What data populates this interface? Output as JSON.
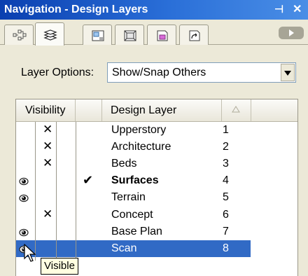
{
  "window": {
    "title": "Navigation - Design Layers",
    "pin_glyph": "⊣",
    "close_glyph": "✕"
  },
  "tabs": [
    {
      "name": "classes-tab-icon"
    },
    {
      "name": "design-layers-tab-icon"
    },
    {
      "name": "sheet-layers-tab-icon"
    },
    {
      "name": "viewports-tab-icon"
    },
    {
      "name": "saved-views-tab-icon"
    },
    {
      "name": "referenced-files-tab-icon"
    }
  ],
  "layer_options": {
    "label": "Layer Options:",
    "selected": "Show/Snap Others"
  },
  "table": {
    "headers": {
      "visibility": "Visibility",
      "design_layer": "Design Layer"
    },
    "rows": [
      {
        "name": "Upperstory",
        "num": "1",
        "state": "invisible",
        "active": false,
        "bold": false
      },
      {
        "name": "Architecture",
        "num": "2",
        "state": "invisible",
        "active": false,
        "bold": false
      },
      {
        "name": "Beds",
        "num": "3",
        "state": "invisible",
        "active": false,
        "bold": false
      },
      {
        "name": "Surfaces",
        "num": "4",
        "state": "visible",
        "active": true,
        "bold": true
      },
      {
        "name": "Terrain",
        "num": "5",
        "state": "visible",
        "active": false,
        "bold": false
      },
      {
        "name": "Concept",
        "num": "6",
        "state": "invisible",
        "active": false,
        "bold": false
      },
      {
        "name": "Base Plan",
        "num": "7",
        "state": "visible",
        "active": false,
        "bold": false
      },
      {
        "name": "Scan",
        "num": "8",
        "state": "visible",
        "active": false,
        "bold": false,
        "selected": true
      }
    ]
  },
  "tooltip": "Visible",
  "colors": {
    "titlebar": "#0a3fb0",
    "selection": "#316ac5",
    "panel": "#ece9d8"
  }
}
